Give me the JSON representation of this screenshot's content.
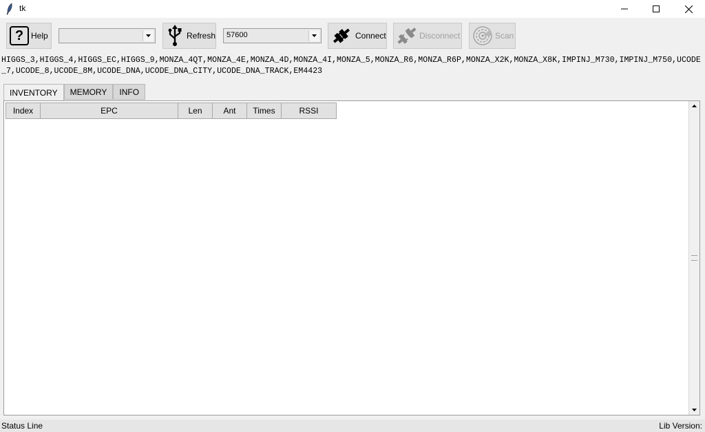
{
  "window": {
    "title": "tk"
  },
  "toolbar": {
    "help_label": "Help",
    "help_icon_text": "?",
    "port_select_value": "",
    "refresh_label": "Refresh",
    "baud_select_value": "57600",
    "connect_label": "Connect",
    "disconnect_label": "Disconnect",
    "scan_label": "Scan"
  },
  "tag_list": "HIGGS_3,HIGGS_4,HIGGS_EC,HIGGS_9,MONZA_4QT,MONZA_4E,MONZA_4D,MONZA_4I,MONZA_5,MONZA_R6,MONZA_R6P,MONZA_X2K,MONZA_X8K,IMPINJ_M730,IMPINJ_M750,UCODE_7,UCODE_8,UCODE_8M,UCODE_DNA,UCODE_DNA_CITY,UCODE_DNA_TRACK,EM4423",
  "tabs": [
    "INVENTORY",
    "MEMORY",
    "INFO"
  ],
  "table": {
    "columns": [
      "Index",
      "EPC",
      "Len",
      "Ant",
      "Times",
      "RSSI"
    ]
  },
  "status": {
    "left": "Status Line",
    "right": "Lib Version:"
  }
}
